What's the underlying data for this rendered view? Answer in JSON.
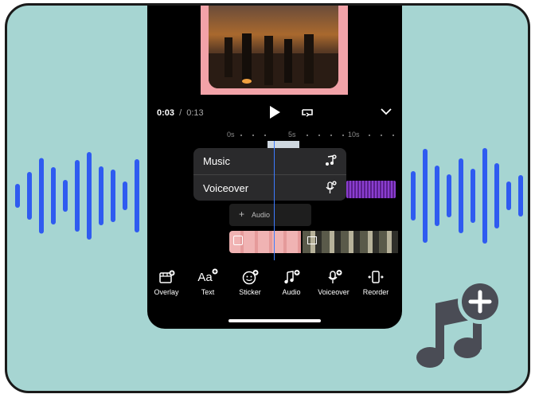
{
  "player": {
    "current_time": "0:03",
    "separator": "/",
    "total_time": "0:13"
  },
  "ruler": {
    "ticks": [
      "0s",
      "5s",
      "10s"
    ]
  },
  "audio_menu": {
    "items": [
      {
        "label": "Music",
        "icon": "music-add-icon"
      },
      {
        "label": "Voiceover",
        "icon": "mic-add-icon"
      }
    ]
  },
  "timeline": {
    "add_audio_label": "Audio"
  },
  "toolbar": {
    "items": [
      {
        "label": "Overlay",
        "icon": "overlay-icon"
      },
      {
        "label": "Text",
        "icon": "text-icon",
        "glyph": "Aa"
      },
      {
        "label": "Sticker",
        "icon": "sticker-icon"
      },
      {
        "label": "Audio",
        "icon": "audio-icon"
      },
      {
        "label": "Voiceover",
        "icon": "voiceover-icon"
      },
      {
        "label": "Reorder",
        "icon": "reorder-icon"
      }
    ]
  },
  "colors": {
    "background": "#a6d5d2",
    "waveform": "#2f5bf0",
    "playhead": "#3d7bff",
    "audio_clip": "#7b2fb5",
    "frame_border": "#f2a2a8",
    "badge_icon": "#4a4c55"
  },
  "decor": {
    "corner_icon": "add-music-icon"
  }
}
